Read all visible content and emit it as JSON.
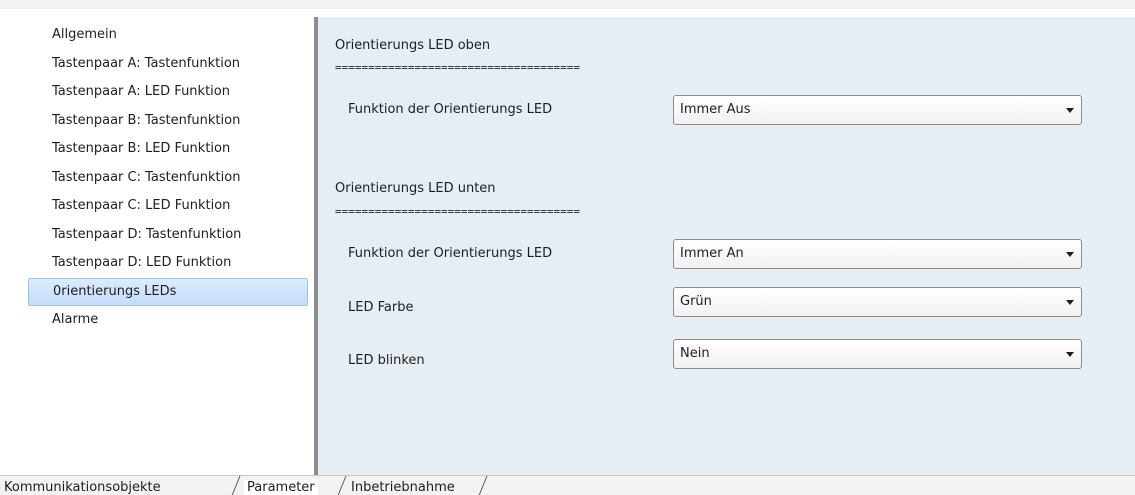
{
  "sidebar": {
    "items": [
      {
        "label": "Allgemein"
      },
      {
        "label": "Tastenpaar A: Tastenfunktion"
      },
      {
        "label": "Tastenpaar A: LED Funktion"
      },
      {
        "label": "Tastenpaar B: Tastenfunktion"
      },
      {
        "label": "Tastenpaar B: LED Funktion"
      },
      {
        "label": "Tastenpaar C: Tastenfunktion"
      },
      {
        "label": "Tastenpaar C: LED Funktion"
      },
      {
        "label": "Tastenpaar D: Tastenfunktion"
      },
      {
        "label": "Tastenpaar D: LED Funktion"
      },
      {
        "label": "0rientierungs LEDs"
      },
      {
        "label": "Alarme"
      }
    ],
    "selected_index": 9
  },
  "content": {
    "section_top": {
      "heading": "Orientierungs LED oben",
      "separator": "=====================================",
      "params": [
        {
          "label": "Funktion der Orientierungs LED",
          "value": "Immer Aus"
        }
      ]
    },
    "section_bottom": {
      "heading": "Orientierungs LED unten",
      "separator": "=====================================",
      "params": [
        {
          "label": "Funktion der Orientierungs LED",
          "value": "Immer An"
        },
        {
          "label": "LED Farbe",
          "value": "Grün"
        },
        {
          "label": "LED blinken",
          "value": "Nein"
        }
      ]
    }
  },
  "tabs": [
    {
      "label": "Kommunikationsobjekte",
      "active": false
    },
    {
      "label": "Parameter",
      "active": true
    },
    {
      "label": "Inbetriebnahme",
      "active": false
    }
  ],
  "colors": {
    "content_background": "#e5eef5",
    "selection_background": "#cfe4fb",
    "selection_border": "#9ac3ee",
    "splitter": "#8d8d8d"
  }
}
